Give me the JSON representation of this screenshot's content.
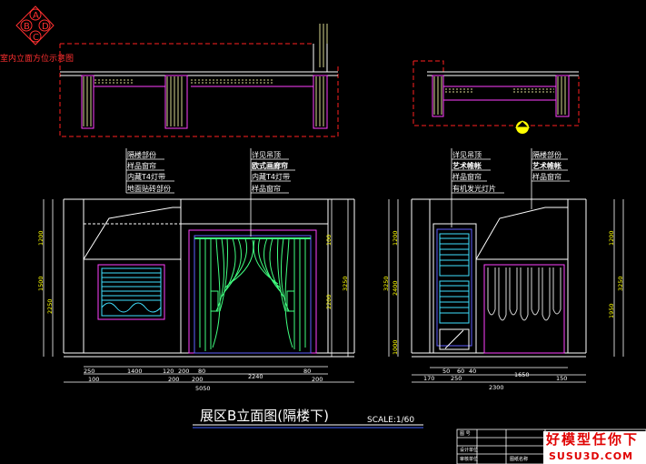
{
  "key_plan": {
    "letters": [
      "A",
      "B",
      "D",
      "C"
    ],
    "caption": "室内立面方位示意图"
  },
  "left_elevation": {
    "annotations_a": [
      "隔楼部份",
      "样品窗帘",
      "内藏T4灯带",
      "地面贴砖部份"
    ],
    "annotations_b": [
      "详见吊顶",
      "欧式画廊帘",
      "内藏T4灯带",
      "样品窗帘"
    ],
    "dims_vertical": [
      "1200",
      "1500",
      "2250",
      "100",
      "2200",
      "3250"
    ],
    "dims_row1": [
      "250",
      "1400",
      "120",
      "200",
      "80",
      "2240",
      "80"
    ],
    "dims_row2": [
      "100",
      "200",
      "200",
      "200"
    ],
    "dim_total": "5050"
  },
  "right_elevation": {
    "annotations_a": [
      "详见吊顶",
      "艺术帷帐",
      "样品窗帘",
      "有机发光灯片"
    ],
    "annotations_b": [
      "隔楼部份",
      "艺术帷帐",
      "样品窗帘"
    ],
    "dims_vertical": [
      "3250",
      "1200",
      "2400",
      "1000",
      "1200",
      "1950",
      "3250"
    ],
    "dims_row1": [
      "50",
      "60",
      "40"
    ],
    "dims_row2": [
      "170",
      "250",
      "1650",
      "150"
    ],
    "dim_total": "2300"
  },
  "title": {
    "main": "展区B立面图(隔楼下)",
    "scale": "SCALE:1/60"
  },
  "title_block": {
    "cells": [
      "图 号",
      "设计单位",
      "审核单位",
      "图纸名称"
    ]
  },
  "watermark": {
    "line1": "好模型任你下",
    "line2": "SUSU3D.COM"
  },
  "colors": {
    "background": "#000000",
    "plan_dashed": "#ff2020",
    "partition": "#ff40ff",
    "drapery": "#40ff80",
    "blind": "#40e0ff",
    "dimension_text": "#ffff00",
    "watermark": "#e00000"
  }
}
